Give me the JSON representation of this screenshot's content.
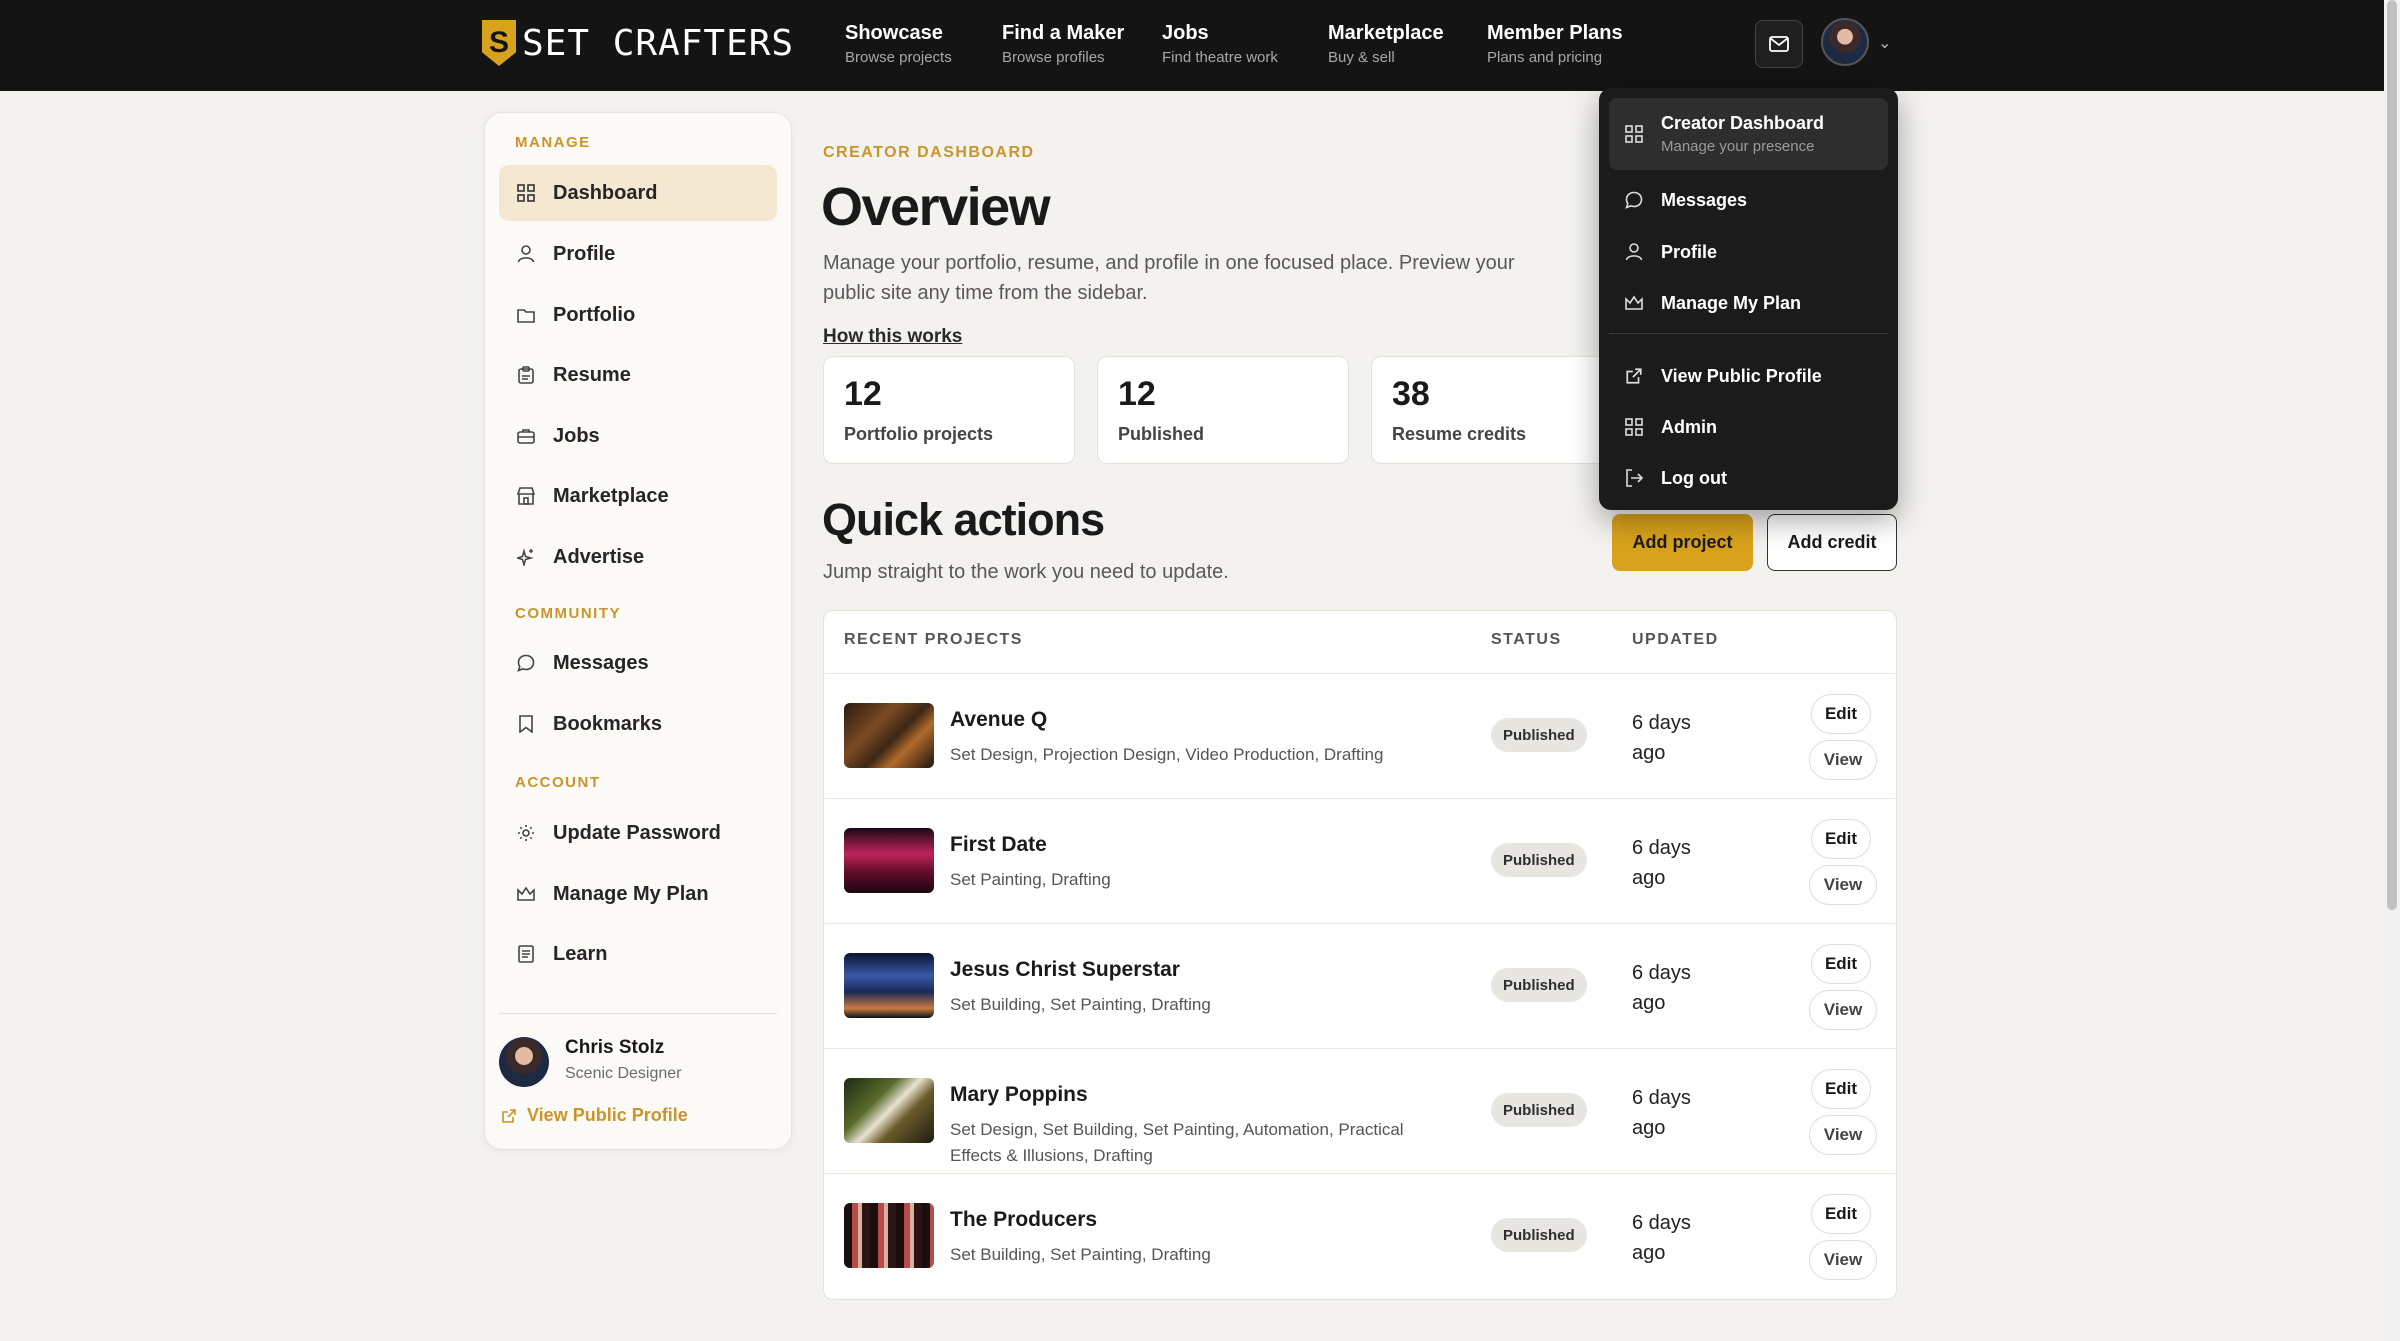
{
  "brand": {
    "name": "SET CRAFTERS",
    "badge": "S"
  },
  "nav": [
    {
      "title": "Showcase",
      "sub": "Browse projects"
    },
    {
      "title": "Find a Maker",
      "sub": "Browse profiles"
    },
    {
      "title": "Jobs",
      "sub": "Find theatre work"
    },
    {
      "title": "Marketplace",
      "sub": "Buy & sell"
    },
    {
      "title": "Member Plans",
      "sub": "Plans and pricing"
    }
  ],
  "sidebar": {
    "sections": [
      "MANAGE",
      "COMMUNITY",
      "ACCOUNT"
    ],
    "items": [
      {
        "label": "Dashboard",
        "icon": "grid-icon"
      },
      {
        "label": "Profile",
        "icon": "person-icon"
      },
      {
        "label": "Portfolio",
        "icon": "folder-icon"
      },
      {
        "label": "Resume",
        "icon": "clipboard-icon"
      },
      {
        "label": "Jobs",
        "icon": "briefcase-icon"
      },
      {
        "label": "Marketplace",
        "icon": "store-icon"
      },
      {
        "label": "Advertise",
        "icon": "sparkle-icon"
      },
      {
        "label": "Messages",
        "icon": "chat-icon"
      },
      {
        "label": "Bookmarks",
        "icon": "bookmark-icon"
      },
      {
        "label": "Update Password",
        "icon": "gear-icon"
      },
      {
        "label": "Manage My Plan",
        "icon": "crown-icon"
      },
      {
        "label": "Learn",
        "icon": "book-icon"
      }
    ],
    "user": {
      "name": "Chris Stolz",
      "role": "Scenic Designer"
    },
    "view_public": "View Public Profile"
  },
  "main": {
    "eyebrow": "CREATOR DASHBOARD",
    "title": "Overview",
    "intro": "Manage your portfolio, resume, and profile in one focused place. Preview your public site any time from the sidebar.",
    "how_link": "How this works",
    "stats": [
      {
        "value": "12",
        "label": "Portfolio projects"
      },
      {
        "value": "12",
        "label": "Published"
      },
      {
        "value": "38",
        "label": "Resume credits"
      }
    ],
    "quick_title": "Quick actions",
    "quick_sub": "Jump straight to the work you need to update.",
    "add_project": "Add project",
    "add_credit": "Add credit"
  },
  "table": {
    "headers": [
      "RECENT PROJECTS",
      "STATUS",
      "UPDATED"
    ],
    "rows": [
      {
        "title": "Avenue Q",
        "tags": "Set Design, Projection Design, Video Production, Drafting",
        "status": "Published",
        "updated": "6 days ago",
        "edit": "Edit",
        "view": "View"
      },
      {
        "title": "First Date",
        "tags": "Set Painting, Drafting",
        "status": "Published",
        "updated": "6 days ago",
        "edit": "Edit",
        "view": "View"
      },
      {
        "title": "Jesus Christ Superstar",
        "tags": "Set Building, Set Painting, Drafting",
        "status": "Published",
        "updated": "6 days ago",
        "edit": "Edit",
        "view": "View"
      },
      {
        "title": "Mary Poppins",
        "tags": "Set Design, Set Building, Set Painting, Automation, Practical Effects & Illusions, Drafting",
        "status": "Published",
        "updated": "6 days ago",
        "edit": "Edit",
        "view": "View"
      },
      {
        "title": "The Producers",
        "tags": "Set Building, Set Painting, Drafting",
        "status": "Published",
        "updated": "6 days ago",
        "edit": "Edit",
        "view": "View"
      }
    ]
  },
  "dropdown": {
    "items": [
      {
        "label": "Creator Dashboard",
        "sub": "Manage your presence",
        "icon": "grid-icon"
      },
      {
        "label": "Messages",
        "icon": "chat-icon"
      },
      {
        "label": "Profile",
        "icon": "person-icon"
      },
      {
        "label": "Manage My Plan",
        "icon": "crown-icon"
      },
      {
        "label": "View Public Profile",
        "icon": "external-link-icon"
      },
      {
        "label": "Admin",
        "icon": "grid-icon"
      },
      {
        "label": "Log out",
        "icon": "logout-icon"
      }
    ]
  },
  "colors": {
    "accent": "#d8a21d",
    "topbar": "#141414",
    "background": "#f3f2ef"
  }
}
